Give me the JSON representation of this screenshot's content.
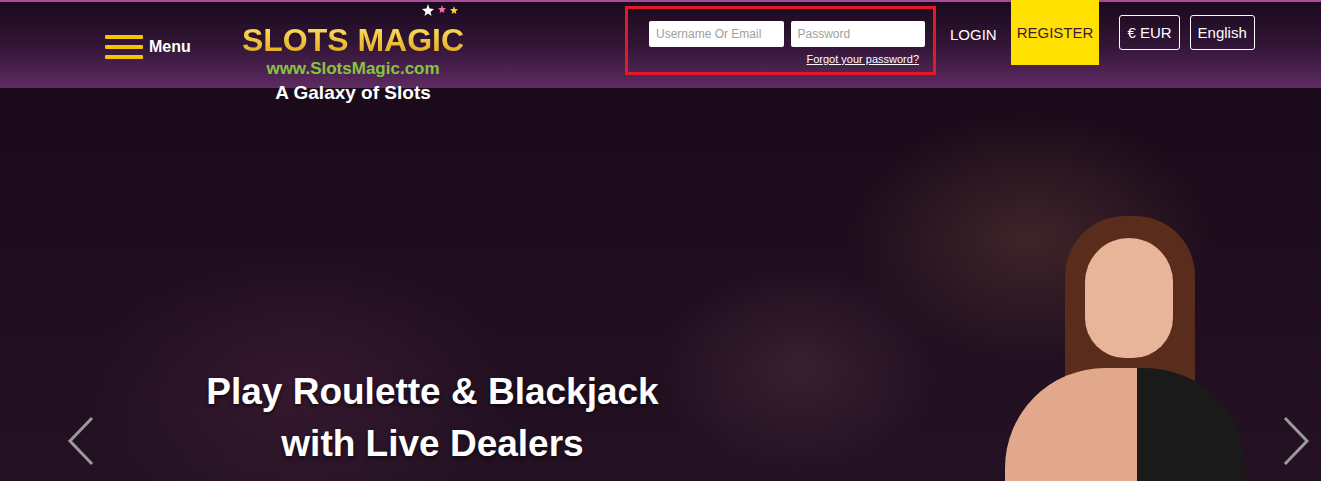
{
  "header": {
    "menu_label": "Menu"
  },
  "logo": {
    "name": "SLOTS MAGIC",
    "url": "www.SlotsMagic.com",
    "tagline": "A Galaxy of Slots"
  },
  "login": {
    "username_placeholder": "Username Or Email",
    "password_placeholder": "Password",
    "forgot_link": "Forgot your password?",
    "login_button": "LOGIN",
    "register_button": "REGISTER"
  },
  "currency": "€ EUR",
  "language": "English",
  "hero": {
    "headline": [
      "Play Roulette & Blackjack",
      "with Live Dealers"
    ]
  }
}
